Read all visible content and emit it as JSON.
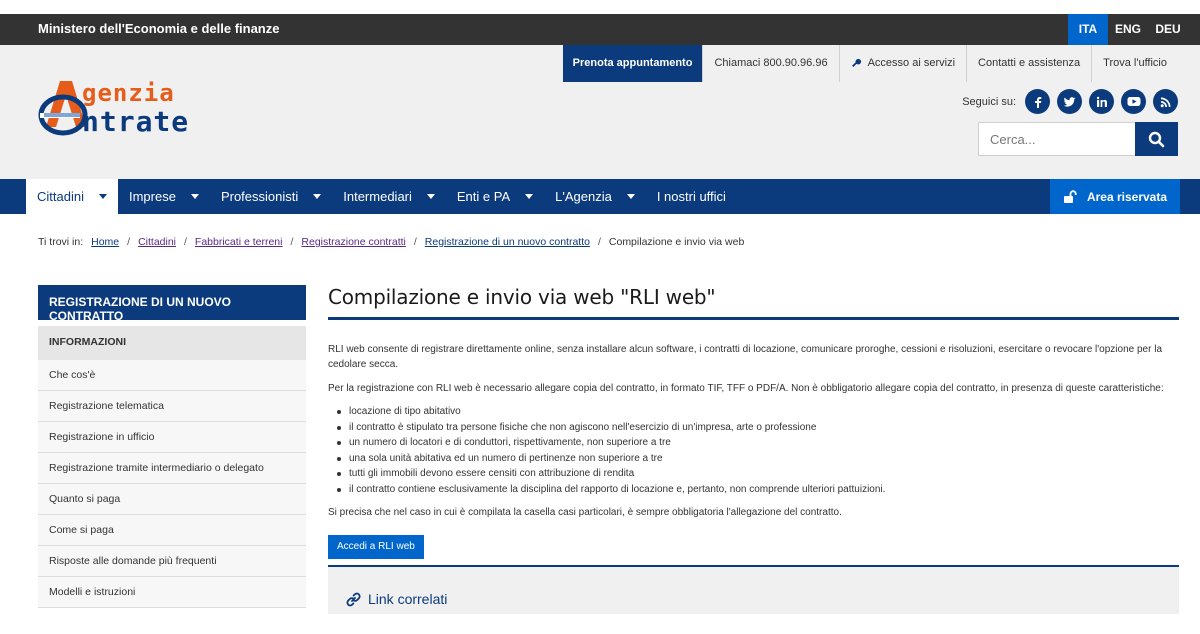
{
  "topbar": {
    "ministry": "Ministero dell'Economia e delle finanze",
    "languages": [
      "ITA",
      "ENG",
      "DEU"
    ],
    "active_language": "ITA"
  },
  "header": {
    "logo": {
      "line1": "genzia",
      "line2": "ntrate"
    },
    "services": {
      "prenota": "Prenota appuntamento",
      "chiamaci": "Chiamaci 800.90.96.96",
      "accesso": "Accesso ai servizi",
      "contatti": "Contatti e assistenza",
      "trova": "Trova l'ufficio"
    },
    "social_label": "Seguici su:",
    "social_icons": [
      "facebook-icon",
      "twitter-icon",
      "linkedin-icon",
      "youtube-icon",
      "rss-icon"
    ],
    "search_placeholder": "Cerca..."
  },
  "nav": {
    "items": [
      {
        "label": "Cittadini"
      },
      {
        "label": "Imprese"
      },
      {
        "label": "Professionisti"
      },
      {
        "label": "Intermediari"
      },
      {
        "label": "Enti e PA"
      },
      {
        "label": "L'Agenzia"
      },
      {
        "label": "I nostri uffici"
      }
    ],
    "area_riservata": "Area riservata"
  },
  "breadcrumb": {
    "prefix": "Ti trovi in:",
    "items": [
      "Home",
      "Cittadini",
      "Fabbricati e terreni",
      "Registrazione contratti",
      "Registrazione di un nuovo contratto"
    ],
    "current": "Compilazione e invio via web"
  },
  "sidebar": {
    "title": "REGISTRAZIONE DI UN NUOVO CONTRATTO",
    "section": "INFORMAZIONI",
    "items": [
      "Che cos'è",
      "Registrazione telematica",
      "Registrazione in ufficio",
      "Registrazione tramite intermediario o delegato",
      "Quanto si paga",
      "Come si paga",
      "Risposte alle domande più frequenti",
      "Modelli e istruzioni"
    ]
  },
  "content": {
    "title": "Compilazione e invio via web \"RLI web\"",
    "p1": "RLI web consente di registrare direttamente online, senza installare alcun software, i contratti di locazione, comunicare proroghe, cessioni e risoluzioni, esercitare o revocare l'opzione per la cedolare secca.",
    "p2": "Per la registrazione con RLI web è necessario allegare copia del contratto, in formato TIF, TFF o PDF/A. Non è obbligatorio allegare copia del contratto, in presenza di queste caratteristiche:",
    "bullets": [
      "locazione di tipo abitativo",
      "il contratto è stipulato tra persone fisiche che non agiscono nell'esercizio di un'impresa, arte o professione",
      "un numero di locatori e di conduttori, rispettivamente, non superiore a tre",
      "una sola unità abitativa ed un numero di pertinenze non superiore a tre",
      "tutti gli immobili devono essere censiti con attribuzione di rendita",
      "il contratto contiene esclusivamente la disciplina del rapporto di locazione e, pertanto, non comprende ulteriori pattuizioni."
    ],
    "p3": "Si precisa che nel caso in cui è compilata la casella casi particolari, è sempre obbligatoria l'allegazione del contratto.",
    "cta": "Accedi a RLI web",
    "related_title": "Link correlati"
  },
  "colors": {
    "brand_blue": "#0b3a7d",
    "accent_blue": "#0066cc",
    "logo_orange": "#e65c1a",
    "topbar": "#333333"
  }
}
